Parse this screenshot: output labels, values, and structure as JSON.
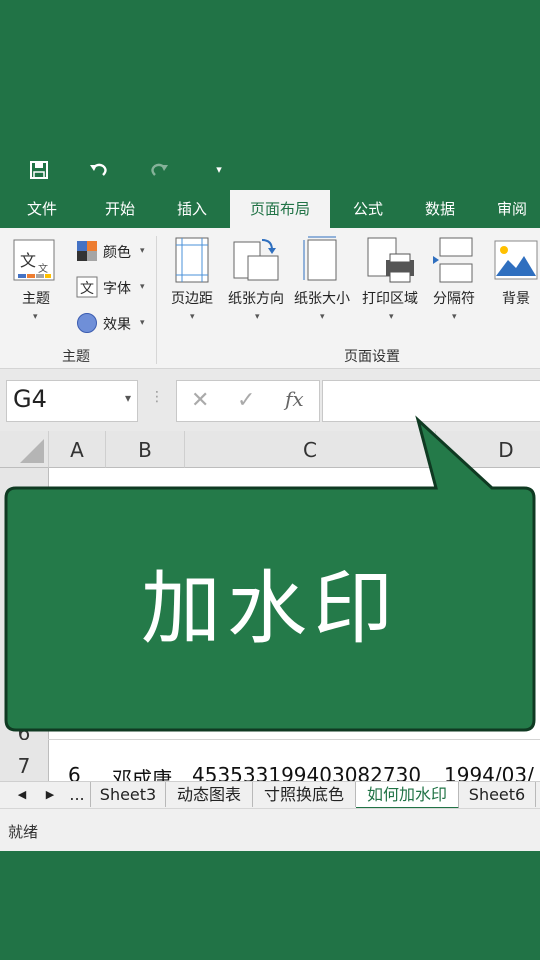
{
  "quick_access": {
    "icons": [
      "save-icon",
      "undo-icon",
      "redo-icon",
      "customize-dropdown-icon"
    ]
  },
  "tabs": [
    {
      "label": "文件",
      "active": false
    },
    {
      "label": "开始",
      "active": false
    },
    {
      "label": "插入",
      "active": false
    },
    {
      "label": "页面布局",
      "active": true
    },
    {
      "label": "公式",
      "active": false
    },
    {
      "label": "数据",
      "active": false
    },
    {
      "label": "审阅",
      "active": false
    }
  ],
  "ribbon": {
    "theme_group": {
      "themes_label": "主题",
      "colors_label": "颜色",
      "fonts_label": "字体",
      "effects_label": "效果",
      "group_label": "主题"
    },
    "page_setup_group": {
      "margins_label": "页边距",
      "orientation_label": "纸张方向",
      "size_label": "纸张大小",
      "print_area_label": "打印区域",
      "breaks_label": "分隔符",
      "background_label": "背景",
      "group_label": "页面设置"
    }
  },
  "formula_bar": {
    "name_box": "G4",
    "fx_label": "fx",
    "value": ""
  },
  "grid": {
    "columns": [
      "A",
      "B",
      "C",
      "D"
    ],
    "visible_rows": [
      {
        "number": "6",
        "cells": [
          "",
          "",
          "",
          ""
        ]
      },
      {
        "number": "7",
        "cells": [
          "6",
          "邓成康",
          "453533199403082730",
          "1994/03/"
        ]
      }
    ]
  },
  "sheet_tabs": {
    "more_label": "...",
    "tabs": [
      {
        "label": "Sheet3",
        "active": false
      },
      {
        "label": "动态图表",
        "active": false
      },
      {
        "label": "寸照换底色",
        "active": false
      },
      {
        "label": "如何加水印",
        "active": true
      },
      {
        "label": "Sheet6",
        "active": false
      }
    ]
  },
  "status_bar": {
    "text": "就绪"
  },
  "overlay": {
    "callout_text": "加水印"
  },
  "colors": {
    "brand_green": "#217346",
    "ribbon_bg": "#f3f3f3",
    "bubble_fill": "#247a49",
    "bubble_border": "#0f3a22"
  }
}
